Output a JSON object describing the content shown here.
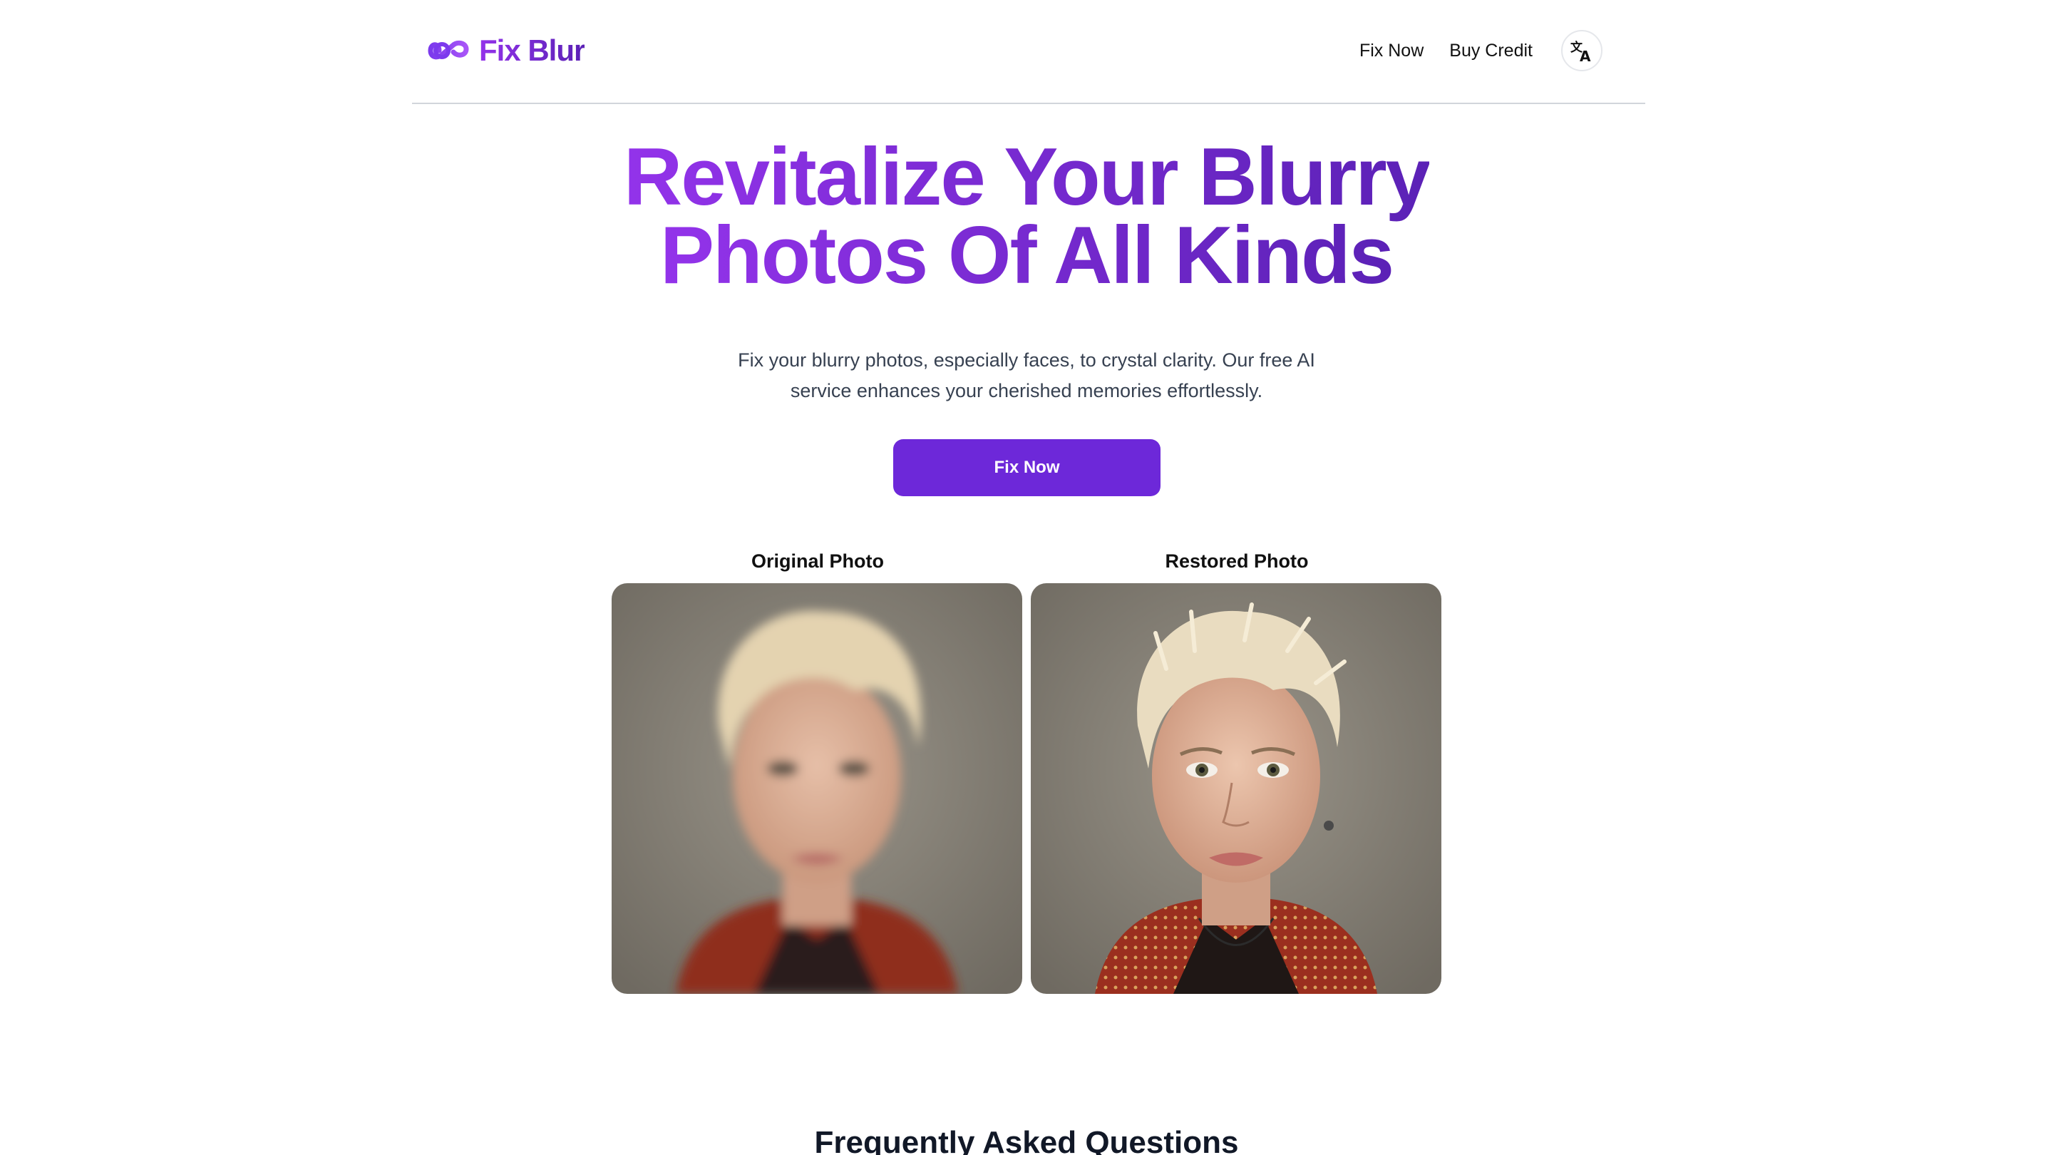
{
  "header": {
    "brand": "Fix Blur",
    "nav": {
      "fix_now": "Fix Now",
      "buy_credit": "Buy Credit"
    },
    "language_icon": "translate-icon"
  },
  "hero": {
    "title_line1": "Revitalize Your Blurry",
    "title_line2": "Photos Of All Kinds",
    "subtitle": "Fix your blurry photos, especially faces, to crystal clarity. Our free AI service enhances your cherished memories effortlessly.",
    "cta_label": "Fix Now"
  },
  "comparison": {
    "original_label": "Original Photo",
    "restored_label": "Restored Photo"
  },
  "faq": {
    "title": "Frequently Asked Questions"
  },
  "colors": {
    "accent": "#6d28d9",
    "gradient_start": "#9333ea",
    "gradient_end": "#5b21b6"
  }
}
